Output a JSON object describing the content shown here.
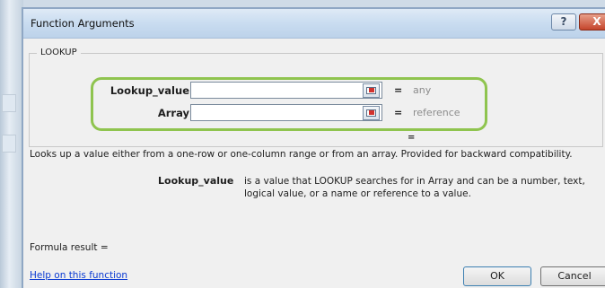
{
  "window": {
    "title": "Function Arguments",
    "help_glyph": "?",
    "close_glyph": "X"
  },
  "function_group": {
    "label": "LOOKUP"
  },
  "arguments": [
    {
      "label": "Lookup_value",
      "value": "",
      "type_hint": "any",
      "equals": "="
    },
    {
      "label": "Array",
      "value": "",
      "type_hint": "reference",
      "equals": "="
    }
  ],
  "result_equals": "=",
  "description": "Looks up a value either from a one-row or one-column range or from an array. Provided for backward compatibility.",
  "param_help": {
    "name": "Lookup_value",
    "text": "is a value that LOOKUP searches for in Array and can be a number, text,\nlogical value, or a name or reference to a value."
  },
  "formula_result": "Formula result =",
  "help_link": "Help on this function",
  "buttons": {
    "ok": "OK",
    "cancel": "Cancel"
  },
  "colors": {
    "highlight": "#8fc44f",
    "link": "#0a3ad2",
    "hint": "#8c8c8c"
  },
  "icons": [
    "help-icon",
    "close-icon",
    "range-select-icon"
  ]
}
